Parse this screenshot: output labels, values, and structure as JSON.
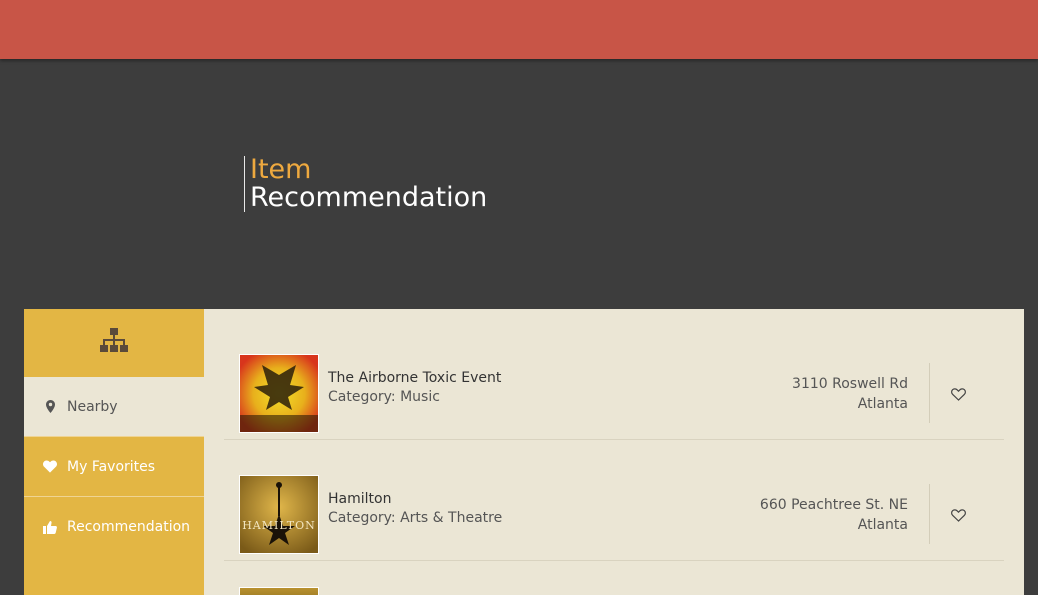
{
  "header": {
    "title_line1": "Item",
    "title_line2": "Recommendation"
  },
  "colors": {
    "topbar": "#c85547",
    "background": "#3d3d3d",
    "accent": "#eea93f",
    "sidebar": "#e3b644",
    "content": "#ebe6d5"
  },
  "sidebar": {
    "head_icon": "sitemap-icon",
    "items": [
      {
        "label": "Nearby",
        "icon": "map-marker-icon",
        "active": true
      },
      {
        "label": "My Favorites",
        "icon": "heart-icon",
        "active": false
      },
      {
        "label": "Recommendation",
        "icon": "thumbs-up-icon",
        "active": false
      }
    ]
  },
  "items": [
    {
      "name": "The Airborne Toxic Event",
      "category": "Category: Music",
      "address_line1": "3110 Roswell Rd",
      "address_line2": "Atlanta",
      "favorite_icon": "heart-outline-icon"
    },
    {
      "name": "Hamilton",
      "category": "Category: Arts & Theatre",
      "address_line1": "660 Peachtree St. NE",
      "address_line2": "Atlanta",
      "favorite_icon": "heart-outline-icon",
      "thumb_text": "HAMILTON"
    }
  ]
}
